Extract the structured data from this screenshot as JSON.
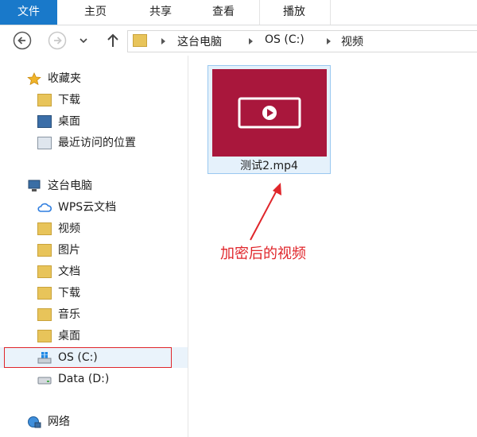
{
  "ribbon": {
    "tabs": [
      "文件",
      "主页",
      "共享",
      "查看",
      "播放"
    ]
  },
  "address": {
    "crumbs": [
      "这台电脑",
      "OS (C:)",
      "视频"
    ]
  },
  "nav": {
    "quick_access": "收藏夹",
    "qa_items": [
      "下载",
      "桌面",
      "最近访问的位置"
    ],
    "this_pc": "这台电脑",
    "pc_items": [
      "WPS云文档",
      "视频",
      "图片",
      "文档",
      "下载",
      "音乐",
      "桌面"
    ],
    "drives": [
      "OS (C:)",
      "Data (D:)"
    ],
    "network": "网络"
  },
  "content": {
    "file_name": "测试2.mp4"
  },
  "annotation": {
    "text": "加密后的视频",
    "color": "#e0262b"
  },
  "colors": {
    "accent": "#1979ca",
    "thumb": "#a9173c"
  }
}
